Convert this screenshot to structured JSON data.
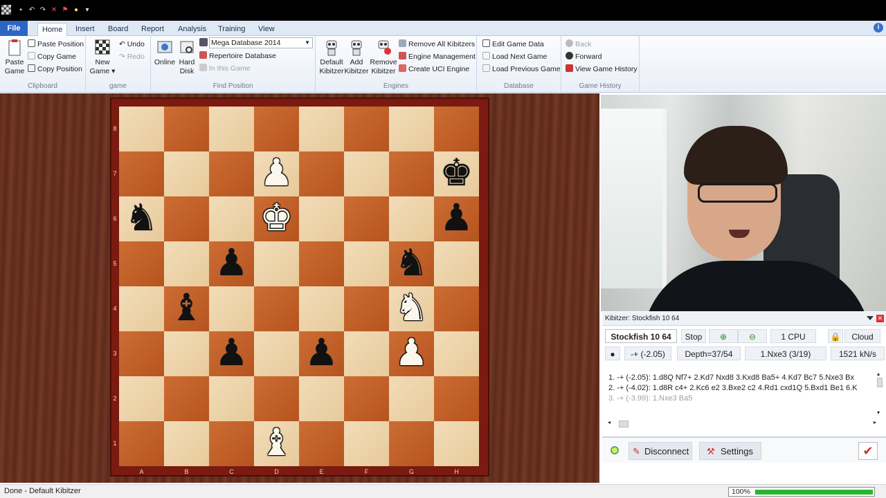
{
  "titlebar": {
    "icons": [
      "app-icon",
      "save-icon",
      "undo-icon",
      "redo-icon",
      "delete-icon",
      "flag-icon",
      "light-icon",
      "more-icon"
    ]
  },
  "tabs": {
    "file": "File",
    "items": [
      "Home",
      "Insert",
      "Board",
      "Report",
      "Analysis",
      "Training",
      "View"
    ],
    "active": "Home"
  },
  "ribbon": {
    "clipboard": {
      "label": "Clipboard",
      "paste_game_1": "Paste",
      "paste_game_2": "Game",
      "paste_position": "Paste Position",
      "copy_game": "Copy Game",
      "copy_position": "Copy Position"
    },
    "game": {
      "label": "game",
      "new_game_1": "New",
      "new_game_2": "Game",
      "undo": "Undo",
      "redo": "Redo"
    },
    "find_position": {
      "label": "Find Position",
      "online": "Online",
      "hard_disk_1": "Hard",
      "hard_disk_2": "Disk",
      "database_select": "Mega Database 2014",
      "repertoire": "Repertoire Database",
      "in_this_game": "In this Game"
    },
    "engines": {
      "label": "Engines",
      "default_kibitzer_1": "Default",
      "default_kibitzer_2": "Kibitzer",
      "add_kibitzer_1": "Add",
      "add_kibitzer_2": "Kibitzer",
      "remove_kibitzer_1": "Remove",
      "remove_kibitzer_2": "Kibitzer",
      "remove_all": "Remove All Kibitzers",
      "engine_management": "Engine Management",
      "create_uci": "Create UCI Engine"
    },
    "database": {
      "label": "Database",
      "edit_game_data": "Edit Game Data",
      "load_next": "Load Next Game",
      "load_previous": "Load Previous Game"
    },
    "game_history": {
      "label": "Game History",
      "back": "Back",
      "forward": "Forward",
      "view_history": "View Game History"
    }
  },
  "board": {
    "ranks": [
      "8",
      "7",
      "6",
      "5",
      "4",
      "3",
      "2",
      "1"
    ],
    "files": [
      "A",
      "B",
      "C",
      "D",
      "E",
      "F",
      "G",
      "H"
    ],
    "pieces": [
      {
        "square": "d7",
        "color": "white",
        "type": "pawn",
        "glyph": "♟"
      },
      {
        "square": "h7",
        "color": "black",
        "type": "king",
        "glyph": "♚"
      },
      {
        "square": "a6",
        "color": "black",
        "type": "knight",
        "glyph": "♞"
      },
      {
        "square": "d6",
        "color": "white",
        "type": "king",
        "glyph": "♚"
      },
      {
        "square": "h6",
        "color": "black",
        "type": "pawn",
        "glyph": "♟"
      },
      {
        "square": "c5",
        "color": "black",
        "type": "pawn",
        "glyph": "♟"
      },
      {
        "square": "g5",
        "color": "black",
        "type": "knight",
        "glyph": "♞"
      },
      {
        "square": "b4",
        "color": "black",
        "type": "bishop",
        "glyph": "♝"
      },
      {
        "square": "g4",
        "color": "white",
        "type": "knight",
        "glyph": "♞"
      },
      {
        "square": "c3",
        "color": "black",
        "type": "pawn",
        "glyph": "♟"
      },
      {
        "square": "e3",
        "color": "black",
        "type": "pawn",
        "glyph": "♟"
      },
      {
        "square": "g3",
        "color": "white",
        "type": "pawn",
        "glyph": "♟"
      },
      {
        "square": "d1",
        "color": "white",
        "type": "bishop",
        "glyph": "♝"
      }
    ]
  },
  "kibitzer": {
    "title": "Kibitzer: Stockfish 10 64",
    "engine_name": "Stockfish 10 64",
    "stop": "Stop",
    "cpu": "1 CPU",
    "cloud": "Cloud",
    "eval": "-+  (-2.05)",
    "depth": "Depth=37/54",
    "current_move": "1.Nxe3 (3/19)",
    "speed": "1521 kN/s",
    "lines": [
      {
        "text": "1. -+  (-2.05): 1.d8Q Nf7+ 2.Kd7 Nxd8 3.Kxd8 Ba5+ 4.Kd7 Bc7 5.Nxe3 Bx",
        "dim": false
      },
      {
        "text": "2. -+  (-4.02): 1.d8R c4+ 2.Kc6 e2 3.Bxe2 c2 4.Rd1 cxd1Q 5.Bxd1 Be1 6.K",
        "dim": false
      },
      {
        "text": "3. -+  (-3.99): 1.Nxe3 Ba5",
        "dim": true
      }
    ],
    "disconnect": "Disconnect",
    "settings": "Settings"
  },
  "status": {
    "text": "Done - Default Kibitzer",
    "zoom": "100%",
    "progress": 0.78
  },
  "colors": {
    "file_tab": "#2a67c5",
    "progress": "#29b62f",
    "board_light": "#f1dcb8",
    "board_dark": "#cc6d34"
  }
}
